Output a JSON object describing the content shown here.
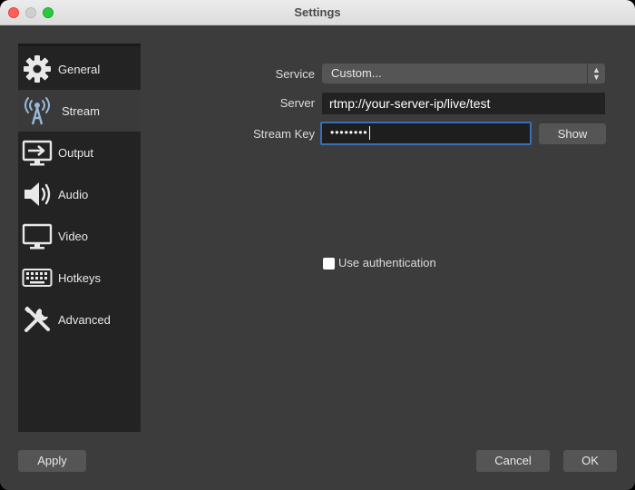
{
  "window": {
    "title": "Settings"
  },
  "sidebar": {
    "items": [
      {
        "label": "General",
        "icon": "gear-icon"
      },
      {
        "label": "Stream",
        "icon": "broadcast-antenna-icon",
        "active": true
      },
      {
        "label": "Output",
        "icon": "output-monitor-icon"
      },
      {
        "label": "Audio",
        "icon": "speaker-icon"
      },
      {
        "label": "Video",
        "icon": "monitor-icon"
      },
      {
        "label": "Hotkeys",
        "icon": "keyboard-icon"
      },
      {
        "label": "Advanced",
        "icon": "tools-icon"
      }
    ]
  },
  "stream": {
    "service_label": "Service",
    "service_value": "Custom...",
    "server_label": "Server",
    "server_value": "rtmp://your-server-ip/live/test",
    "stream_key_label": "Stream Key",
    "stream_key_value": "••••••••",
    "show_label": "Show",
    "auth_label": "Use authentication",
    "auth_checked": false
  },
  "footer": {
    "apply_label": "Apply",
    "cancel_label": "Cancel",
    "ok_label": "OK"
  },
  "colors": {
    "background": "#3c3c3c",
    "sidebar": "#232323",
    "field": "#222222",
    "button": "#555555",
    "focus": "#3a6fb5"
  }
}
